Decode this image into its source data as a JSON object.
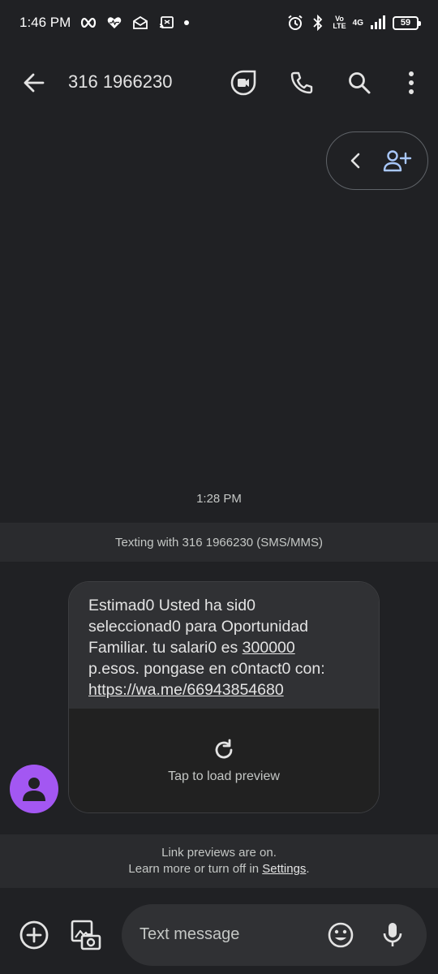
{
  "status_bar": {
    "time": "1:46 PM",
    "network": "4G",
    "volte_line1": "Vo",
    "volte_line2": "LTE",
    "battery": "59"
  },
  "app_bar": {
    "title": "316 1966230",
    "icons": [
      "back-arrow-icon",
      "video-call-icon",
      "phone-icon",
      "search-icon",
      "more-vert-icon"
    ]
  },
  "contact_pill": {
    "icons": [
      "chevron-left-icon",
      "add-contact-icon"
    ]
  },
  "conversation": {
    "timestamp": "1:28 PM",
    "info_banner": "Texting with 316 1966230 (SMS/MMS)",
    "message": {
      "line1": "Estimad0 Usted ha sid0",
      "line2": "seleccionad0 para Oportunidad",
      "line3_prefix": "Familiar. tu salari0 es ",
      "amount": "300000",
      "line4": "p.esos. pongase en c0ntact0 con:",
      "link": "https://wa.me/66943854680"
    },
    "preview_label": "Tap to load preview"
  },
  "notice": {
    "line1": "Link previews are on.",
    "line2_prefix": "Learn more or turn off in ",
    "settings_link": "Settings",
    "line2_suffix": "."
  },
  "compose": {
    "placeholder": "Text message"
  },
  "colors": {
    "background": "#202124",
    "avatar": "#a357f2",
    "accent_blue": "#a8c7fa",
    "bubble": "#303134"
  }
}
